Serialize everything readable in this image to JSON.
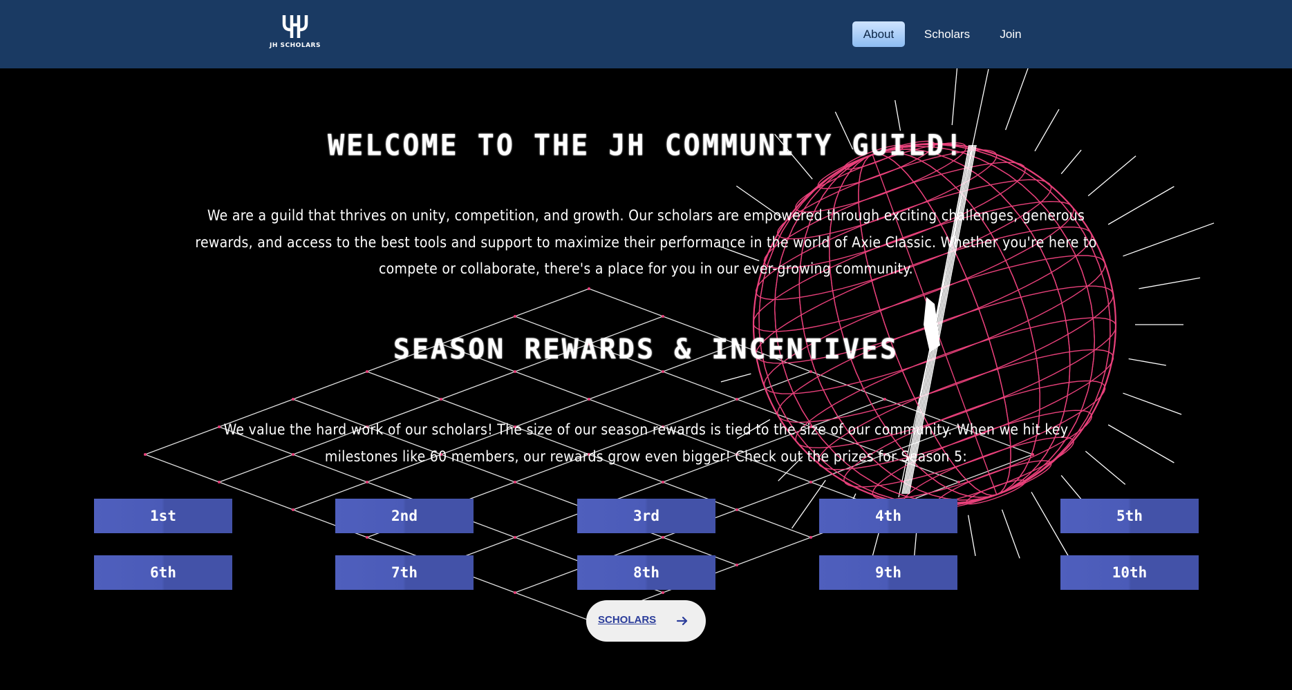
{
  "header": {
    "logo_text": "JH SCHOLARS",
    "nav": [
      {
        "label": "About",
        "active": true
      },
      {
        "label": "Scholars",
        "active": false
      },
      {
        "label": "Join",
        "active": false
      }
    ]
  },
  "main": {
    "welcome_title": "WELCOME TO THE JH COMMUNITY GUILD!",
    "intro_text": "We are a guild that thrives on unity, competition, and growth. Our scholars are empowered through exciting challenges, generous rewards, and access to the best tools and support to maximize their performance in the world of Axie Classic. Whether you're here to compete or collaborate, there's a place for you in our ever-growing community.",
    "rewards_title": "SEASON REWARDS & INCENTIVES",
    "rewards_text": "We value the hard work of our scholars! The size of our season rewards is tied to the size of our community. When we hit key milestones like 60 members, our rewards grow even bigger! Check out the prizes for Season 5:",
    "prizes": [
      "1st",
      "2nd",
      "3rd",
      "4th",
      "5th",
      "6th",
      "7th",
      "8th",
      "9th",
      "10th"
    ],
    "cta_label": "SCHOLARS"
  },
  "icons": {
    "logo": "jh-monogram-icon",
    "cta": "arrow-right-icon"
  },
  "colors": {
    "navbar": "#1a3a63",
    "background": "#000000",
    "sphere": "#e8407a",
    "prize_button": "#4a59b3",
    "active_nav": "#a9d0ff"
  }
}
